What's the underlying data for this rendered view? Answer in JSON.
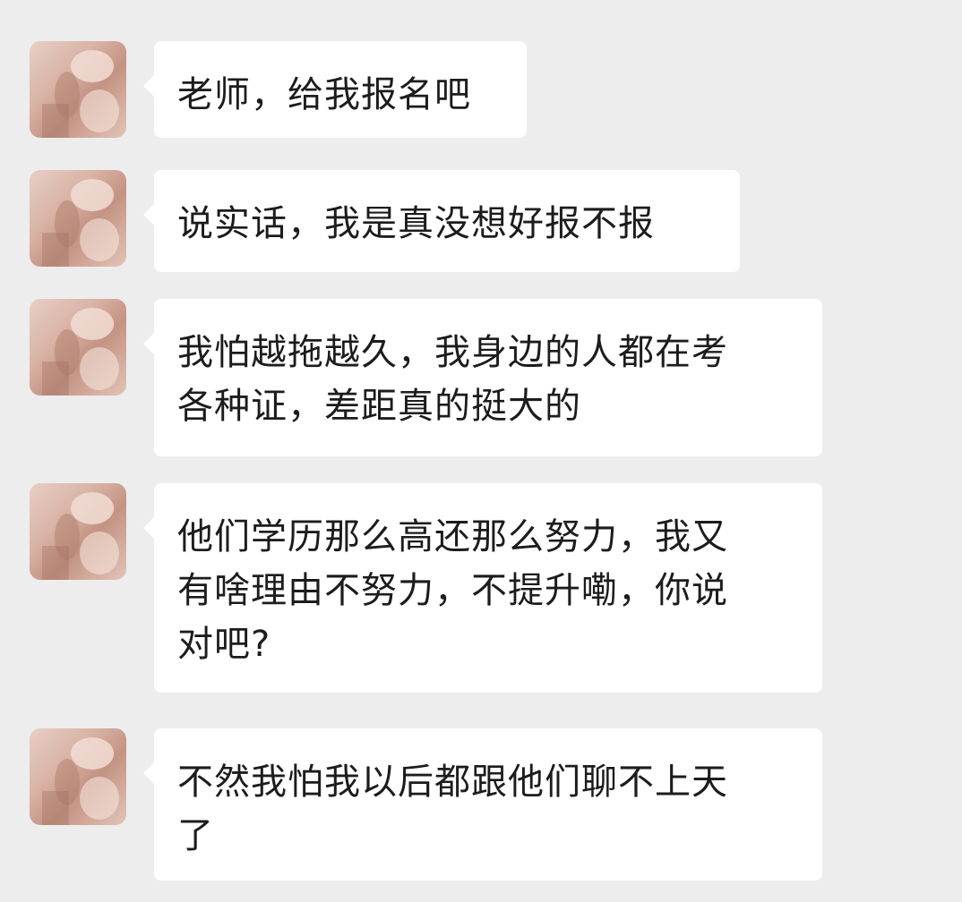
{
  "chat": {
    "messages": [
      {
        "sender": "contact",
        "avatar_icon": "contact-avatar-icon",
        "text": "老师，给我报名吧"
      },
      {
        "sender": "contact",
        "avatar_icon": "contact-avatar-icon",
        "text": "说实话，我是真没想好报不报"
      },
      {
        "sender": "contact",
        "avatar_icon": "contact-avatar-icon",
        "text": "我怕越拖越久，我身边的人都在考\n各种证，差距真的挺大的"
      },
      {
        "sender": "contact",
        "avatar_icon": "contact-avatar-icon",
        "text": "他们学历那么高还那么努力，我又\n有啥理由不努力，不提升嘞，你说\n对吧?"
      },
      {
        "sender": "contact",
        "avatar_icon": "contact-avatar-icon",
        "text": "不然我怕我以后都跟他们聊不上天\n了"
      }
    ]
  },
  "colors": {
    "background": "#ededed",
    "bubble": "#ffffff",
    "text": "#1c1c1c"
  }
}
